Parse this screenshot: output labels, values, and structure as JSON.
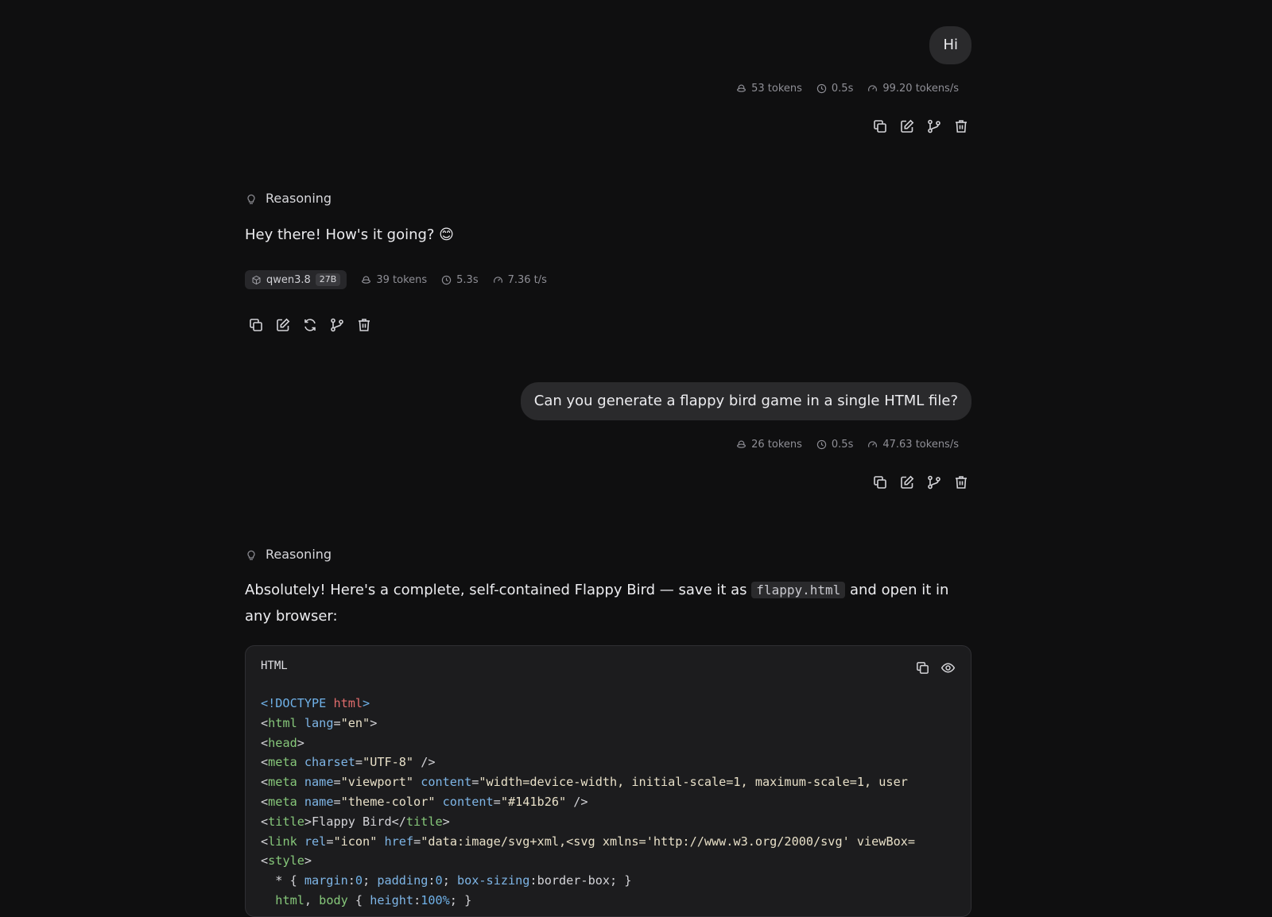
{
  "messages": [
    {
      "role": "user",
      "text": "Hi",
      "stats": {
        "tokens": "53 tokens",
        "time": "0.5s",
        "speed": "99.20 tokens/s"
      }
    },
    {
      "role": "assistant",
      "reasoning_label": "Reasoning",
      "text": "Hey there! How's it going? 😊",
      "model": {
        "name": "qwen3.8",
        "size": "27B"
      },
      "stats": {
        "tokens": "39 tokens",
        "time": "5.3s",
        "speed": "7.36 t/s"
      }
    },
    {
      "role": "user",
      "text": "Can you generate a flappy bird game in a single HTML file?",
      "stats": {
        "tokens": "26 tokens",
        "time": "0.5s",
        "speed": "47.63 tokens/s"
      }
    },
    {
      "role": "assistant",
      "reasoning_label": "Reasoning",
      "text_before": "Absolutely! Here's a complete, self-contained Flappy Bird — save it as ",
      "inline_code": "flappy.html",
      "text_after": " and open it in any browser:",
      "code_language": "HTML",
      "code_lines": [
        "<!DOCTYPE html>",
        "<html lang=\"en\">",
        "<head>",
        "<meta charset=\"UTF-8\" />",
        "<meta name=\"viewport\" content=\"width=device-width, initial-scale=1, maximum-scale=1, user",
        "<meta name=\"theme-color\" content=\"#141b26\" />",
        "<title>Flappy Bird</title>",
        "<link rel=\"icon\" href=\"data:image/svg+xml,<svg xmlns='http://www.w3.org/2000/svg' viewBox=",
        "<style>",
        "  * { margin:0; padding:0; box-sizing:border-box; }",
        "  html, body { height:100%; }"
      ]
    }
  ],
  "icons": {
    "stat_tokens": "tokens-icon",
    "stat_time": "clock-icon",
    "stat_speed": "gauge-icon",
    "reasoning": "lightbulb-icon",
    "model": "cube-icon",
    "copy": "copy-icon",
    "edit": "edit-icon",
    "regenerate": "refresh-icon",
    "branch": "branch-icon",
    "delete": "trash-icon",
    "preview": "eye-icon"
  }
}
